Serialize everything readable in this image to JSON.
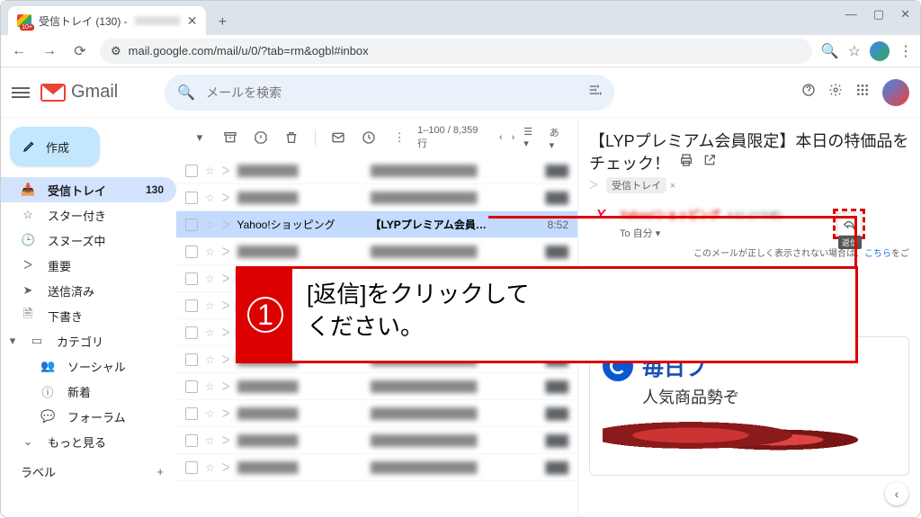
{
  "browser": {
    "tab_title": "受信トレイ (130) -",
    "favicon_badge": "10+",
    "url": "mail.google.com/mail/u/0/?tab=rm&ogbl#inbox"
  },
  "header": {
    "logo_text": "Gmail",
    "search_placeholder": "メールを検索"
  },
  "compose_label": "作成",
  "sidebar": {
    "items": [
      {
        "icon": "inbox",
        "label": "受信トレイ",
        "count": "130",
        "active": true
      },
      {
        "icon": "star",
        "label": "スター付き"
      },
      {
        "icon": "clock",
        "label": "スヌーズ中"
      },
      {
        "icon": "chev",
        "label": "重要"
      },
      {
        "icon": "send",
        "label": "送信済み"
      },
      {
        "icon": "file",
        "label": "下書き"
      },
      {
        "icon": "cat",
        "label": "カテゴリ",
        "expandable": true
      }
    ],
    "sub": [
      "ソーシャル",
      "新着",
      "フォーラム"
    ],
    "more": "もっと見る",
    "labels_header": "ラベル"
  },
  "toolbar": {
    "pagination": "1–100 / 8,359 行",
    "lang": "あ"
  },
  "selected_row": {
    "sender": "Yahoo!ショッピング",
    "subject": "【LYPプレミアム会員…",
    "time": "8:52"
  },
  "reading": {
    "subject": "【LYPプレミアム会員限定】本日の特価品をチェック！",
    "label": "受信トレイ",
    "to": "To 自分",
    "warn_prefix": "このメールが正しく表示されない場合は、",
    "warn_link": "こちら",
    "warn_suffix": "をご",
    "brand_shop": "ショッピング",
    "ad_title": "毎日プ",
    "ad_sub": "人気商品勢ぞ"
  },
  "reply_label": "返信",
  "callout": {
    "num": "1",
    "line1": "[返信]をクリックして",
    "line2": "ください。"
  }
}
